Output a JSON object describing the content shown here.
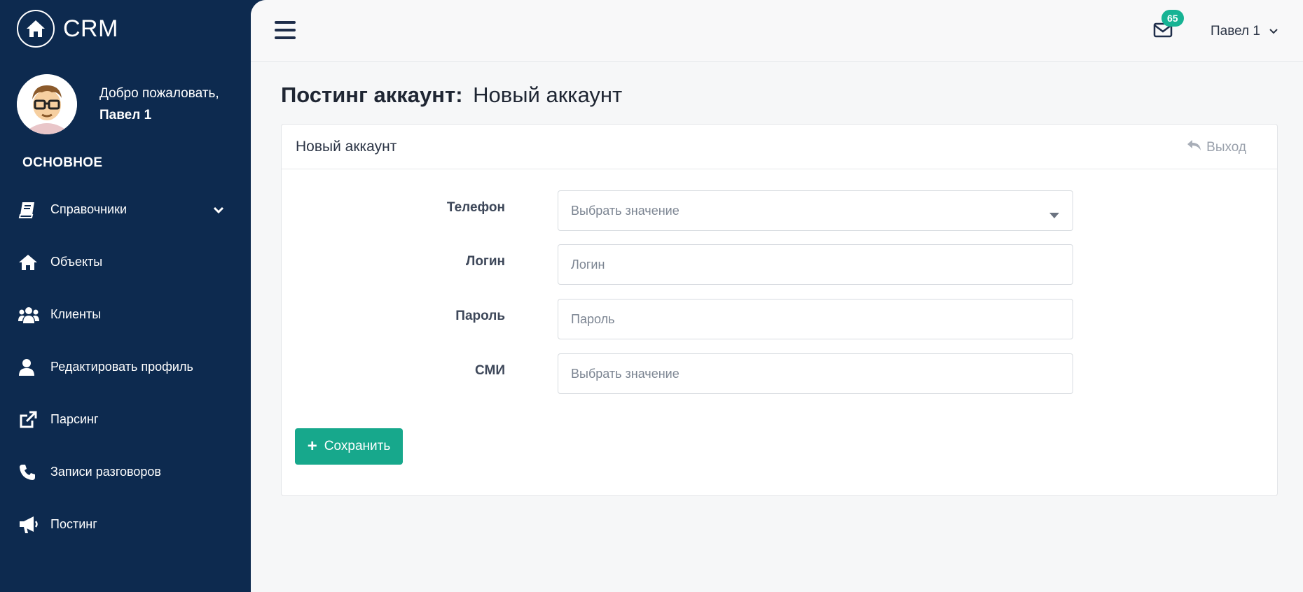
{
  "brand": {
    "name": "CRM"
  },
  "user": {
    "welcome": "Добро пожаловать,",
    "name": "Павел 1"
  },
  "sidebar": {
    "section_title": "ОСНОВНОЕ",
    "items": [
      {
        "label": "Справочники",
        "icon": "book-icon",
        "has_submenu": true
      },
      {
        "label": "Объекты",
        "icon": "home-icon"
      },
      {
        "label": "Клиенты",
        "icon": "users-icon"
      },
      {
        "label": "Редактировать профиль",
        "icon": "user-icon"
      },
      {
        "label": "Парсинг",
        "icon": "external-link-icon"
      },
      {
        "label": "Записи разговоров",
        "icon": "phone-icon"
      },
      {
        "label": "Постинг",
        "icon": "megaphone-icon"
      }
    ]
  },
  "topbar": {
    "mail_count": "65",
    "user_menu_label": "Павел 1"
  },
  "page": {
    "title_strong": "Постинг аккаунт:",
    "title_light": "Новый аккаунт"
  },
  "card": {
    "title": "Новый аккаунт",
    "exit_label": "Выход"
  },
  "form": {
    "phone": {
      "label": "Телефон",
      "placeholder": "Выбрать значение"
    },
    "login": {
      "label": "Логин",
      "placeholder": "Логин"
    },
    "password": {
      "label": "Пароль",
      "placeholder": "Пароль"
    },
    "media": {
      "label": "СМИ",
      "placeholder": "Выбрать значение"
    },
    "save_label": "Сохранить"
  },
  "colors": {
    "sidebar_bg": "#0d2a4f",
    "accent": "#17a88c",
    "badge": "#17b394",
    "content_bg": "#f6f7f8"
  }
}
